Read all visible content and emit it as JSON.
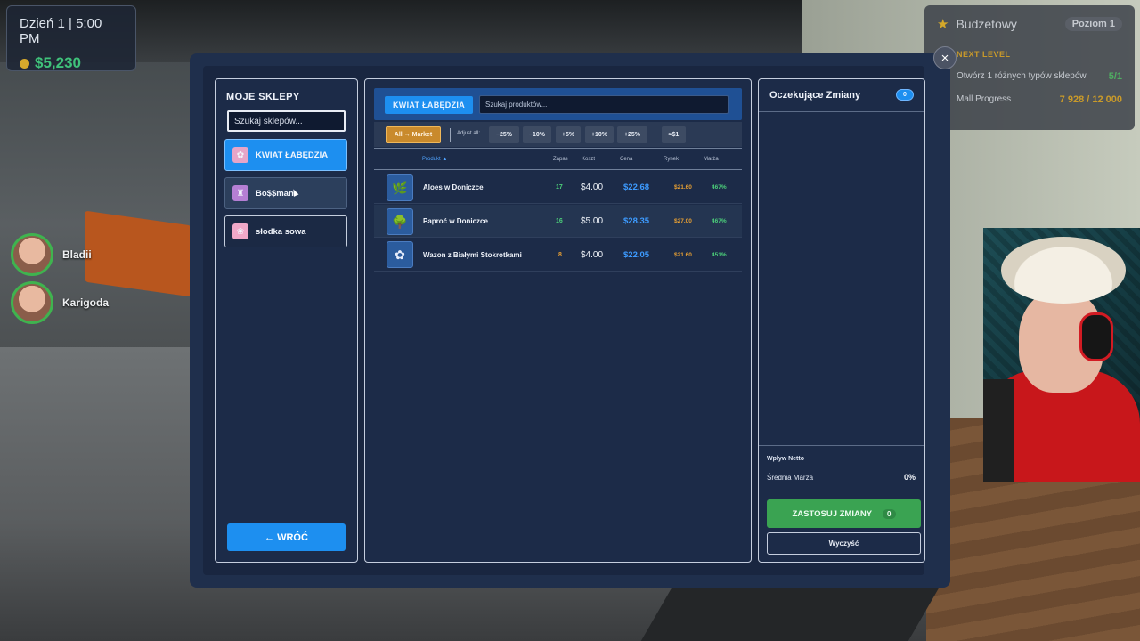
{
  "hud": {
    "day_time": "Dzień 1 | 5:00 PM",
    "money": "$5,230",
    "icon": "money-bag-icon"
  },
  "players": [
    {
      "name": "Bladii"
    },
    {
      "name": "Karigoda"
    }
  ],
  "budget": {
    "title": "Budżetowy",
    "level": "Poziom 1",
    "next_level": "NEXT LEVEL",
    "goal_label": "Otwórz 1 różnych typów sklepów",
    "goal_value": "5/1",
    "progress_label": "Mall Progress",
    "progress_value": "7 928 / 12 000"
  },
  "close_icon": "×",
  "left_panel": {
    "title": "MOJE SKLEPY",
    "search_placeholder": "Szukaj sklepów...",
    "shops": [
      {
        "name": "KWIAT ŁABĘDZIA",
        "active": true
      },
      {
        "name": "Bo$$man",
        "active": false
      },
      {
        "name": "słodka sowa",
        "active": false
      }
    ],
    "back_button": "← WRÓĆ"
  },
  "middle_panel": {
    "shop_tag": "KWIAT ŁABĘDZIA",
    "search_placeholder": "Szukaj produktów...",
    "toolbar": {
      "market_button": "All → Market",
      "adjust_label": "Adjust all:",
      "buttons": [
        "−25%",
        "−10%",
        "+5%",
        "+10%",
        "+25%"
      ],
      "round_button": "≈$1"
    },
    "columns": {
      "product": "Produkt ▲",
      "stock": "Zapas",
      "cost": "Koszt",
      "price": "Cena",
      "market": "Rynek",
      "margin": "Marża"
    },
    "rows": [
      {
        "name": "Aloes w Doniczce",
        "stock": "17",
        "stock_color": "#4ccf7a",
        "cost": "$4.00",
        "price": "$22.68",
        "market": "$21.60",
        "margin": "467%"
      },
      {
        "name": "Paproć w Doniczce",
        "stock": "16",
        "stock_color": "#4ccf7a",
        "cost": "$5.00",
        "price": "$28.35",
        "market": "$27.00",
        "margin": "467%"
      },
      {
        "name": "Wazon z Białymi Stokrotkami",
        "stock": "8",
        "stock_color": "#e8a033",
        "cost": "$4.00",
        "price": "$22.05",
        "market": "$21.60",
        "margin": "451%"
      }
    ]
  },
  "right_panel": {
    "title": "Oczekujące Zmiany",
    "badge": "0",
    "net_label": "Wpływ Netto",
    "avg_margin_label": "Średnia Marża",
    "avg_margin_value": "0%",
    "apply_button": "ZASTOSUJ ZMIANY",
    "apply_count": "0",
    "clear_button": "Wyczyść"
  }
}
